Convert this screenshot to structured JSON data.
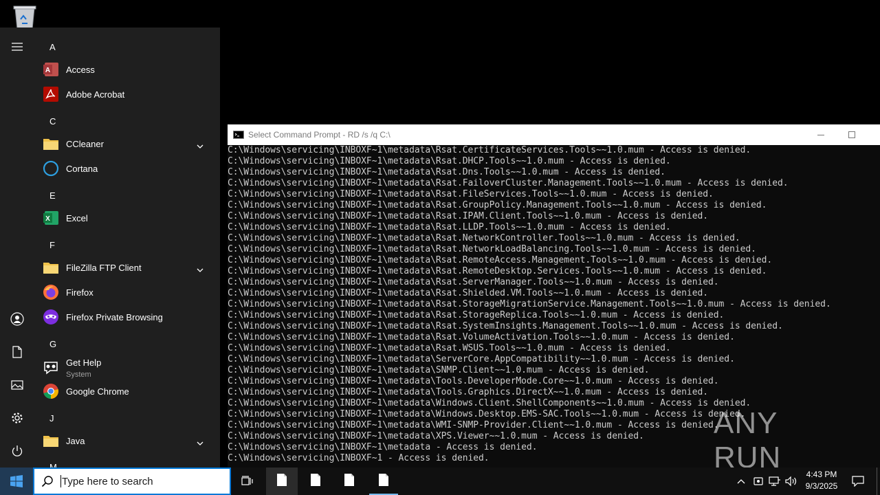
{
  "start_menu": {
    "groups": {
      "a": "A",
      "c": "C",
      "e": "E",
      "f": "F",
      "g": "G",
      "j": "J",
      "m": "M"
    },
    "apps": {
      "access": "Access",
      "acrobat": "Adobe Acrobat",
      "ccleaner": "CCleaner",
      "cortana": "Cortana",
      "excel": "Excel",
      "filezilla": "FileZilla FTP Client",
      "firefox": "Firefox",
      "firefox_private": "Firefox Private Browsing",
      "get_help": "Get Help",
      "get_help_sub": "System",
      "chrome": "Google Chrome",
      "java": "Java"
    }
  },
  "console": {
    "title": "Select Command Prompt - RD  /s /q C:\\",
    "lines": [
      "C:\\Windows\\servicing\\INBOXF~1\\metadata\\Rsat.CertificateServices.Tools~~1.0.mum - Access is denied.",
      "C:\\Windows\\servicing\\INBOXF~1\\metadata\\Rsat.DHCP.Tools~~1.0.mum - Access is denied.",
      "C:\\Windows\\servicing\\INBOXF~1\\metadata\\Rsat.Dns.Tools~~1.0.mum - Access is denied.",
      "C:\\Windows\\servicing\\INBOXF~1\\metadata\\Rsat.FailoverCluster.Management.Tools~~1.0.mum - Access is denied.",
      "C:\\Windows\\servicing\\INBOXF~1\\metadata\\Rsat.FileServices.Tools~~1.0.mum - Access is denied.",
      "C:\\Windows\\servicing\\INBOXF~1\\metadata\\Rsat.GroupPolicy.Management.Tools~~1.0.mum - Access is denied.",
      "C:\\Windows\\servicing\\INBOXF~1\\metadata\\Rsat.IPAM.Client.Tools~~1.0.mum - Access is denied.",
      "C:\\Windows\\servicing\\INBOXF~1\\metadata\\Rsat.LLDP.Tools~~1.0.mum - Access is denied.",
      "C:\\Windows\\servicing\\INBOXF~1\\metadata\\Rsat.NetworkController.Tools~~1.0.mum - Access is denied.",
      "C:\\Windows\\servicing\\INBOXF~1\\metadata\\Rsat.NetworkLoadBalancing.Tools~~1.0.mum - Access is denied.",
      "C:\\Windows\\servicing\\INBOXF~1\\metadata\\Rsat.RemoteAccess.Management.Tools~~1.0.mum - Access is denied.",
      "C:\\Windows\\servicing\\INBOXF~1\\metadata\\Rsat.RemoteDesktop.Services.Tools~~1.0.mum - Access is denied.",
      "C:\\Windows\\servicing\\INBOXF~1\\metadata\\Rsat.ServerManager.Tools~~1.0.mum - Access is denied.",
      "C:\\Windows\\servicing\\INBOXF~1\\metadata\\Rsat.Shielded.VM.Tools~~1.0.mum - Access is denied.",
      "C:\\Windows\\servicing\\INBOXF~1\\metadata\\Rsat.StorageMigrationService.Management.Tools~~1.0.mum - Access is denied.",
      "C:\\Windows\\servicing\\INBOXF~1\\metadata\\Rsat.StorageReplica.Tools~~1.0.mum - Access is denied.",
      "C:\\Windows\\servicing\\INBOXF~1\\metadata\\Rsat.SystemInsights.Management.Tools~~1.0.mum - Access is denied.",
      "C:\\Windows\\servicing\\INBOXF~1\\metadata\\Rsat.VolumeActivation.Tools~~1.0.mum - Access is denied.",
      "C:\\Windows\\servicing\\INBOXF~1\\metadata\\Rsat.WSUS.Tools~~1.0.mum - Access is denied.",
      "C:\\Windows\\servicing\\INBOXF~1\\metadata\\ServerCore.AppCompatibility~~1.0.mum - Access is denied.",
      "C:\\Windows\\servicing\\INBOXF~1\\metadata\\SNMP.Client~~1.0.mum - Access is denied.",
      "C:\\Windows\\servicing\\INBOXF~1\\metadata\\Tools.DeveloperMode.Core~~1.0.mum - Access is denied.",
      "C:\\Windows\\servicing\\INBOXF~1\\metadata\\Tools.Graphics.DirectX~~1.0.mum - Access is denied.",
      "C:\\Windows\\servicing\\INBOXF~1\\metadata\\Windows.Client.ShellComponents~~1.0.mum - Access is denied.",
      "C:\\Windows\\servicing\\INBOXF~1\\metadata\\Windows.Desktop.EMS-SAC.Tools~~1.0.mum - Access is denied.",
      "C:\\Windows\\servicing\\INBOXF~1\\metadata\\WMI-SNMP-Provider.Client~~1.0.mum - Access is denied.",
      "C:\\Windows\\servicing\\INBOXF~1\\metadata\\XPS.Viewer~~1.0.mum - Access is denied.",
      "C:\\Windows\\servicing\\INBOXF~1\\metadata - Access is denied.",
      "C:\\Windows\\servicing\\INBOXF~1 - Access is denied."
    ]
  },
  "watermark": {
    "text": "ANY RUN"
  },
  "taskbar": {
    "search_placeholder": "Type here to search",
    "time": "4:43 PM",
    "date": "9/3/2025"
  },
  "colors": {
    "accent": "#0078d7",
    "start_bg": "#1f1f1f",
    "taskbar_bg": "#101010",
    "console_bg": "#0c0c0c",
    "console_text": "#cccccc"
  },
  "icons": [
    "recycle-bin-icon",
    "hamburger-icon",
    "user-icon",
    "documents-icon",
    "pictures-icon",
    "settings-icon",
    "power-icon",
    "access-icon",
    "acrobat-icon",
    "folder-icon",
    "cortana-icon",
    "excel-icon",
    "firefox-icon",
    "firefox-private-icon",
    "get-help-icon",
    "chrome-icon",
    "chevron-down-icon",
    "cmd-icon",
    "minimize-icon",
    "maximize-icon",
    "windows-logo-icon",
    "search-icon",
    "task-view-icon",
    "file-icon",
    "chevron-up-icon",
    "network-icon",
    "volume-icon",
    "notification-icon"
  ]
}
